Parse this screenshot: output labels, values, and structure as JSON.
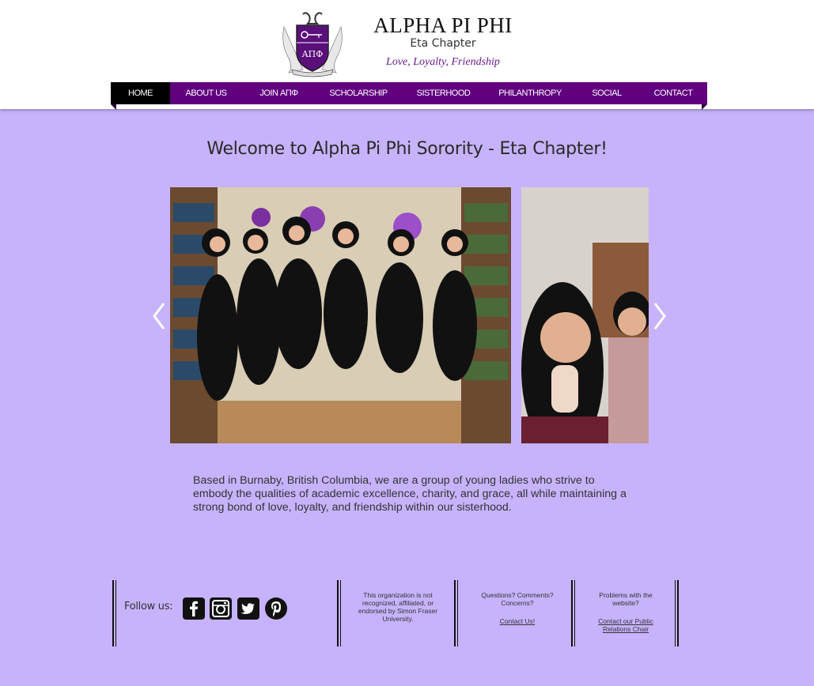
{
  "brand": {
    "title": "ALPHA PI PHI",
    "subtitle": "Eta Chapter",
    "motto": "Love, Loyalty, Friendship",
    "crest_letters": "ΑΠΦ"
  },
  "nav": {
    "items": [
      {
        "label": "HOME",
        "active": true
      },
      {
        "label": "ABOUT US"
      },
      {
        "label": "JOIN ΑΠΦ"
      },
      {
        "label": "SCHOLARSHIP"
      },
      {
        "label": "SISTERHOOD"
      },
      {
        "label": "PHILANTHROPY"
      },
      {
        "label": "SOCIAL"
      },
      {
        "label": "CONTACT"
      }
    ]
  },
  "main": {
    "welcome": "Welcome to Alpha Pi Phi Sorority - Eta Chapter!",
    "intro": "Based in Burnaby, British Columbia, we are a group of young ladies who strive to embody the qualities of academic excellence, charity, and grace, all while maintaining a strong bond of love, loyalty, and friendship within our sisterhood."
  },
  "footer": {
    "follow_label": "Follow us:",
    "social_icons": [
      "facebook-icon",
      "instagram-icon",
      "twitter-icon",
      "pinterest-icon"
    ],
    "disclaimer": "This organization is not recognized, affiliated, or endorsed by Simon Fraser University.",
    "questions": "Questions? Comments? Concerns?",
    "contact_link": "Contact Us!",
    "problems": "Problems with the website?",
    "pr_link": "Contact our Public Relations Chair"
  },
  "colors": {
    "page_bg": "#c6b3fb",
    "nav_bg": "#61007e",
    "nav_active": "#000000",
    "motto": "#6a1a8c"
  }
}
